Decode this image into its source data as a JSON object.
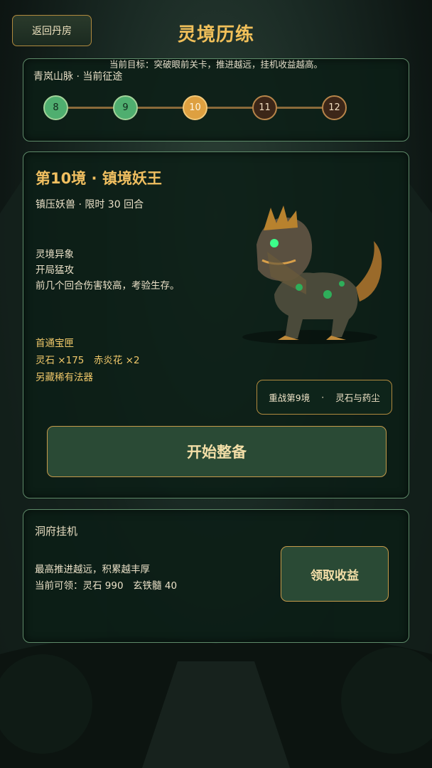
{
  "header": {
    "back_label": "返回丹房",
    "title": "灵境历练",
    "objective": "当前目标：突破眼前关卡，推进越远，挂机收益越高。"
  },
  "progress": {
    "label": "青岚山脉 · 当前征途",
    "nodes": [
      {
        "num": "8",
        "state": "done"
      },
      {
        "num": "9",
        "state": "done"
      },
      {
        "num": "10",
        "state": "current"
      },
      {
        "num": "11",
        "state": "locked"
      },
      {
        "num": "12",
        "state": "locked"
      }
    ]
  },
  "stage": {
    "title": "第10境 · 镇境妖王",
    "subtitle": "镇压妖兽 · 限时 30 回合",
    "anomaly_title": "灵境异象",
    "anomaly_name": "开局猛攻",
    "anomaly_desc": "前几个回合伤害较高，考验生存。",
    "reward_title": "首通宝匣",
    "reward_line1": "灵石 ×175　赤炎花 ×2",
    "reward_line2": "另藏稀有法器",
    "retry_label": "重战第9境",
    "retry_sep": "·",
    "retry_reward": "灵石与药尘",
    "start_label": "开始整备"
  },
  "idle": {
    "title": "洞府挂机",
    "desc1": "最高推进越远，积累越丰厚",
    "desc2": "当前可领：灵石 990　玄铁髓 40",
    "claim_label": "领取收益"
  },
  "colors": {
    "gold": "#f0bf60",
    "done_node": "#4fae6f",
    "current_node": "#dea040",
    "locked_node": "#3c2618",
    "panel_border": "#5e8a69"
  }
}
